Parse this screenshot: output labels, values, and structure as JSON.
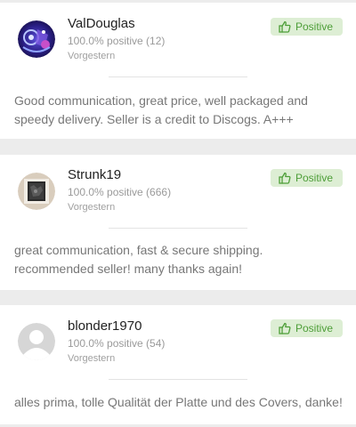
{
  "feedback": [
    {
      "username": "ValDouglas",
      "rating": "100.0% positive (12)",
      "date": "Vorgestern",
      "badge": "Positive",
      "comment": "Good communication, great price, well packaged and speedy delivery. Seller is a credit to Discogs. A+++"
    },
    {
      "username": "Strunk19",
      "rating": "100.0% positive (666)",
      "date": "Vorgestern",
      "badge": "Positive",
      "comment": "great communication, fast & secure shipping. recommended seller! many thanks again!"
    },
    {
      "username": "blonder1970",
      "rating": "100.0% positive (54)",
      "date": "Vorgestern",
      "badge": "Positive",
      "comment": "alles prima, tolle Qualität der Platte und des Covers, danke!"
    }
  ],
  "colors": {
    "positive_badge_bg": "#ddeed4",
    "positive_badge_text": "#4d9e38",
    "page_background": "#ececec"
  },
  "icons": {
    "badge_icon": "thumbs-up-icon",
    "default_avatar": "user-silhouette-icon"
  }
}
